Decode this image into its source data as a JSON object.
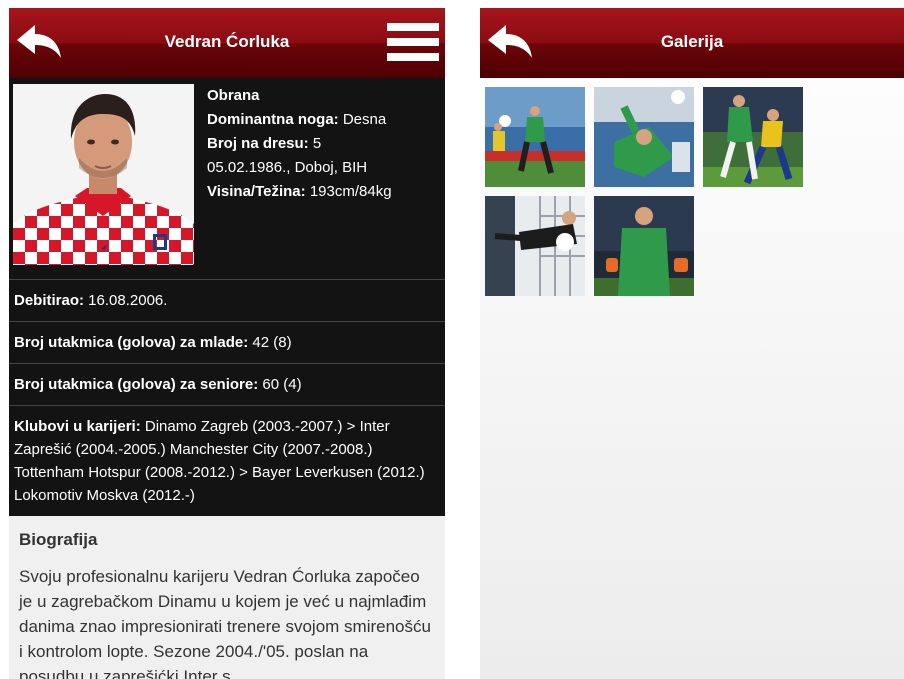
{
  "profile": {
    "header": {
      "title": "Vedran Ćorluka"
    },
    "position": "Obrana",
    "foot": {
      "label": "Dominantna noga:",
      "value": " Desna"
    },
    "jersey": {
      "label": "Broj na dresu:",
      "value": " 5"
    },
    "birth": "05.02.1986., Doboj, BIH",
    "size": {
      "label": "Visina/Težina:",
      "value": " 193cm/84kg"
    },
    "debut": {
      "label": "Debitirao:",
      "value": " 16.08.2006."
    },
    "youth": {
      "label": "Broj utakmica (golova) za mlade:",
      "value": " 42 (8)"
    },
    "senior": {
      "label": "Broj utakmica (golova) za seniore:",
      "value": " 60 (4)"
    },
    "clubs": {
      "label": "Klubovi u karijeri:",
      "value": " Dinamo Zagreb (2003.-2007.) > Inter Zaprešić (2004.-2005.) Manchester City (2007.-2008.) Tottenham Hotspur (2008.-2012.) > Bayer Leverkusen (2012.) Lokomotiv Moskva (2012.-)"
    },
    "bio": {
      "title": "Biografija",
      "text": "Svoju profesionalnu karijeru Vedran Ćorluka započeo je u zagrebačkom Dinamu u kojem je već u najmlađim danima znao impresionirati trenere svojom smirenošću i kontrolom lopte. Sezone 2004./'05. poslan na posudbu u zaprešićki Inter s"
    }
  },
  "gallery": {
    "header": {
      "title": "Galerija"
    }
  },
  "colors": {
    "header_red": "#8a0c12",
    "info_bg": "#131313",
    "jersey_red": "#d8162a",
    "keeper_green": "#2f9b4a"
  },
  "icons": [
    "back-arrow-icon",
    "hamburger-menu-icon"
  ]
}
